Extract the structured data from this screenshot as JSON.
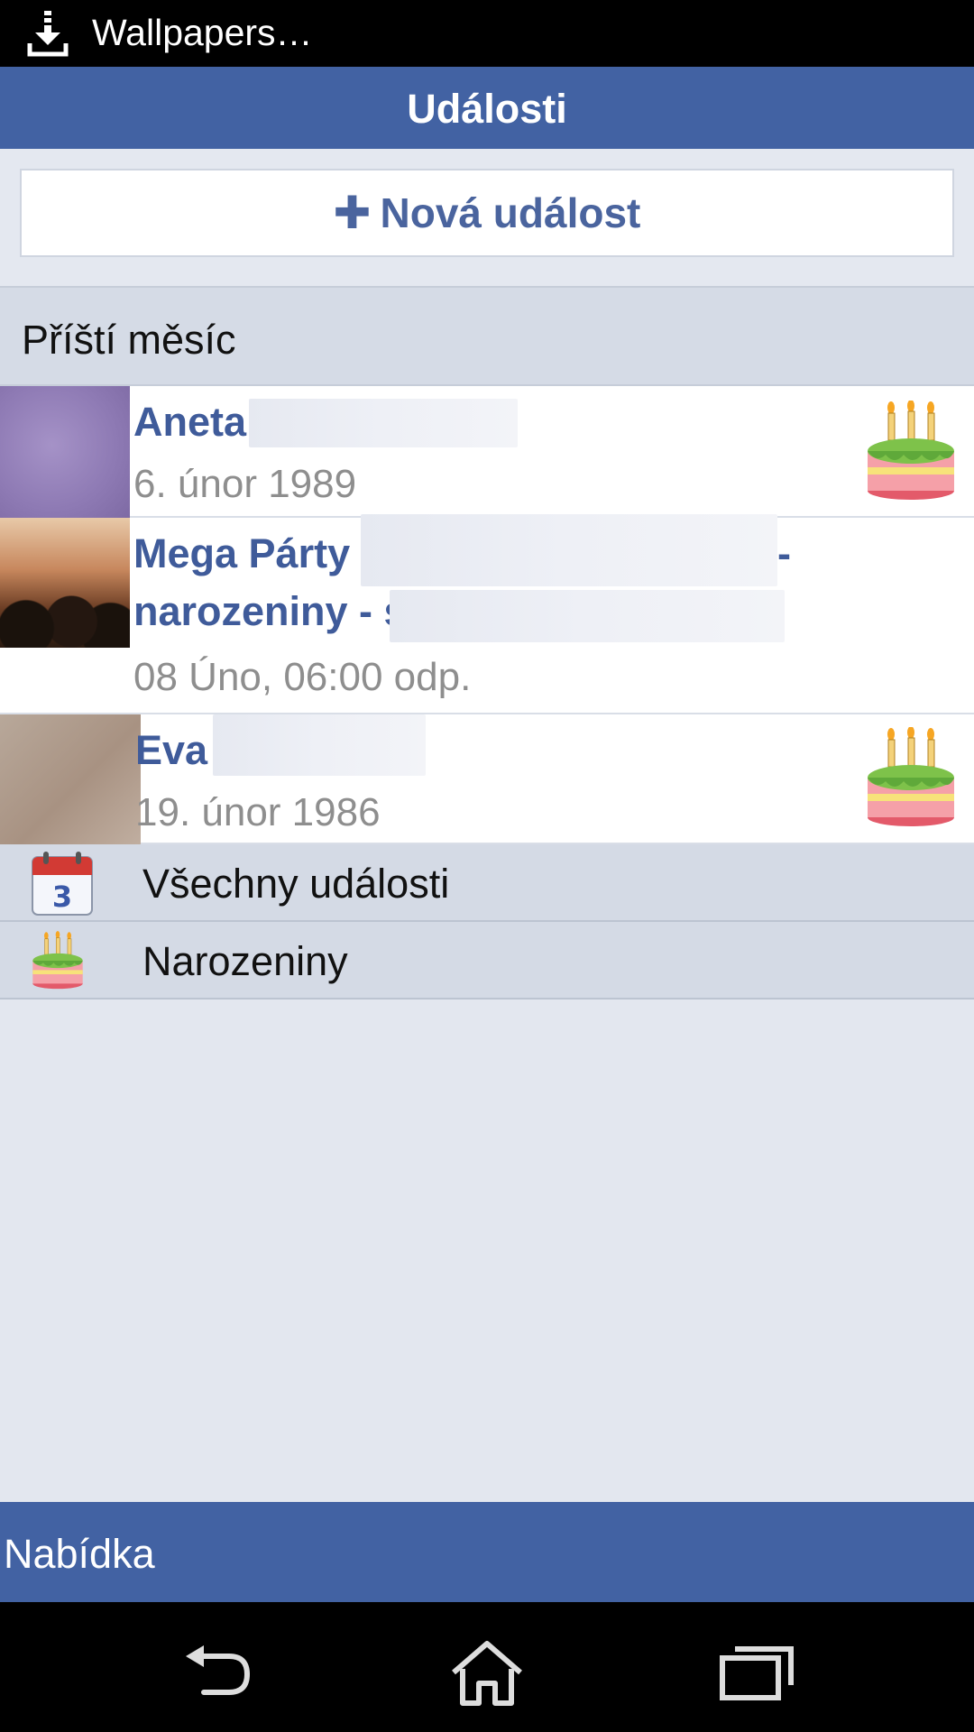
{
  "status_bar": {
    "notification": "Wallpapers…",
    "icon": "download-icon"
  },
  "action_bar": {
    "title": "Události"
  },
  "new_event": {
    "label": "Nová událost",
    "icon": "plus-icon"
  },
  "section": {
    "title": "Příští měsíc"
  },
  "events": [
    {
      "name": "Aneta",
      "date": "6. únor 1989",
      "icon": "birthday-cake-icon"
    },
    {
      "name_line1": "Mega Párty",
      "name_line1_suffix": "-",
      "name_line2": "narozeniny - s",
      "date": "08 Úno, 06:00 odp."
    },
    {
      "name": "Eva",
      "date": "19. únor 1986",
      "icon": "birthday-cake-icon"
    }
  ],
  "menu": [
    {
      "label": "Všechny události",
      "icon": "calendar-icon",
      "calendar_day": "3"
    },
    {
      "label": "Narozeniny",
      "icon": "birthday-cake-icon"
    }
  ],
  "bottom_menu": {
    "label": "Nabídka"
  },
  "nav": {
    "back": "back-icon",
    "home": "home-icon",
    "recents": "recent-apps-icon"
  },
  "colors": {
    "brand_blue": "#4262a3",
    "link_blue": "#3f5b9a",
    "muted_gray": "#8e8e8e"
  }
}
